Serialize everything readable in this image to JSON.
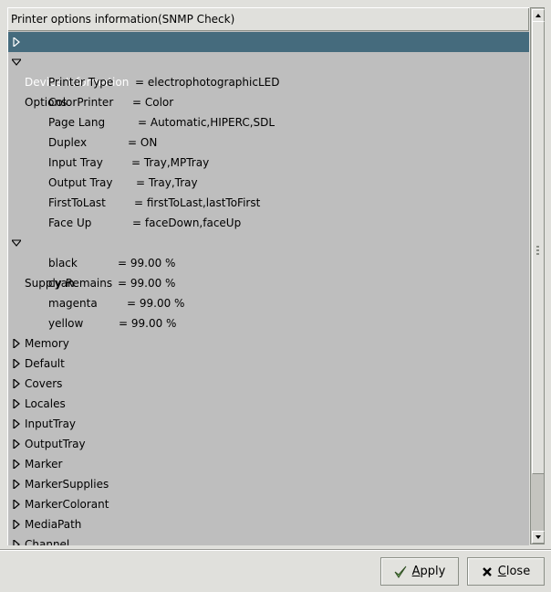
{
  "window": {
    "header": "Printer options information(SNMP Check)"
  },
  "tree": {
    "device_information": "Device Information",
    "options": {
      "label": "Options",
      "items": [
        {
          "key": "Printer Type",
          "value": "= electrophotographicLED"
        },
        {
          "key": "ColorPrinter",
          "value": "= Color"
        },
        {
          "key": "Page Lang",
          "value": "= Automatic,HIPERC,SDL"
        },
        {
          "key": "Duplex",
          "value": "= ON"
        },
        {
          "key": "Input Tray",
          "value": "= Tray,MPTray"
        },
        {
          "key": "Output Tray",
          "value": "= Tray,Tray"
        },
        {
          "key": "FirstToLast",
          "value": "= firstToLast,lastToFirst"
        },
        {
          "key": "Face Up",
          "value": "= faceDown,faceUp"
        }
      ]
    },
    "supply_remains": {
      "label": "Supply Remains",
      "items": [
        {
          "key": "black",
          "value": "= 99.00 %"
        },
        {
          "key": "cyan",
          "value": "= 99.00 %"
        },
        {
          "key": "magenta",
          "value": "= 99.00 %"
        },
        {
          "key": "yellow",
          "value": "= 99.00 %"
        }
      ]
    },
    "collapsed": [
      "Memory",
      "Default",
      "Covers",
      "Locales",
      "InputTray",
      "OutputTray",
      "Marker",
      "MarkerSupplies",
      "MarkerColorant",
      "MediaPath",
      "Channel"
    ]
  },
  "buttons": {
    "apply": {
      "mnemonic": "A",
      "rest": "pply",
      "icon": "check-icon"
    },
    "close": {
      "mnemonic": "C",
      "rest": "lose",
      "icon": "x-icon"
    }
  }
}
